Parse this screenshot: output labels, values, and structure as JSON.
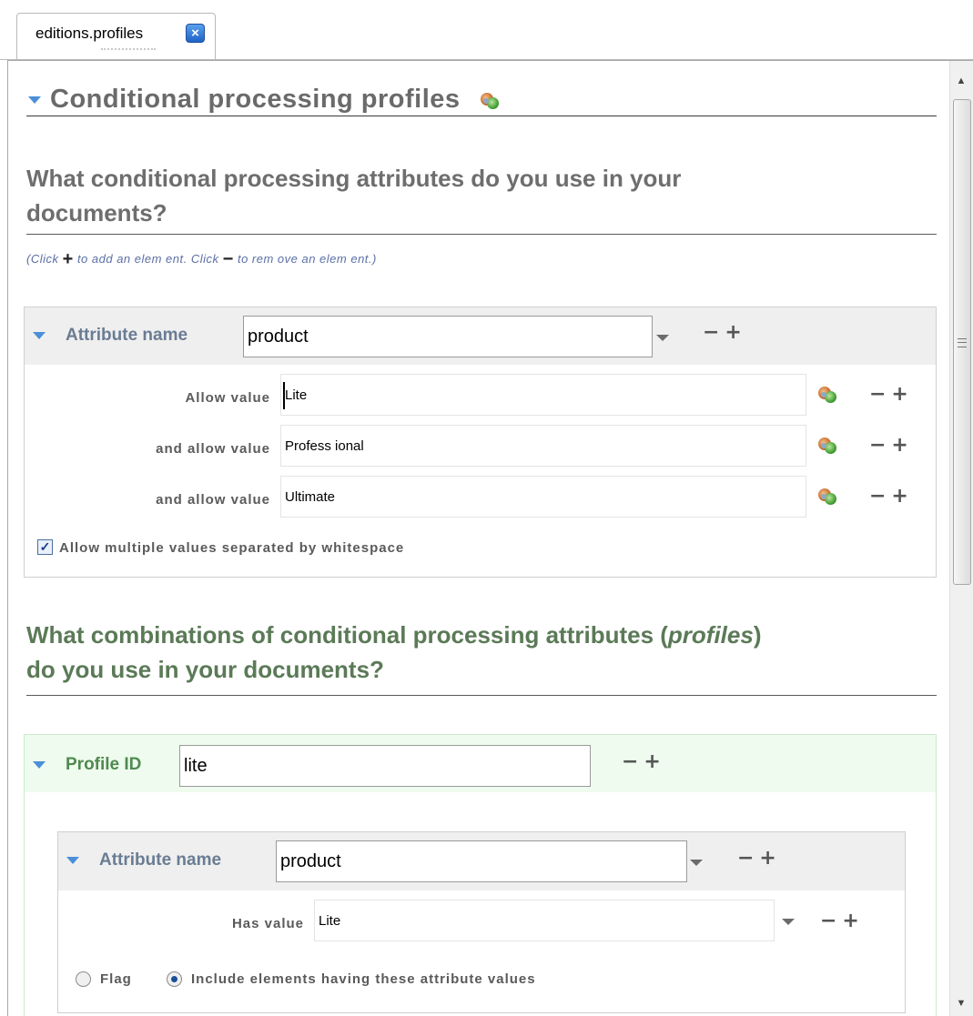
{
  "tab": {
    "title": "editions.profiles",
    "close_icon": "close-icon"
  },
  "section": {
    "title": "Conditional processing profiles"
  },
  "attributes": {
    "question_line1": "What conditional processing attributes do you use in your",
    "question_line2": "documents?",
    "hint_click": "(Click",
    "hint_add": "to add an elem ent. Click",
    "hint_remove": "to rem ove an elem ent.)",
    "plus_symbol": "+",
    "minus_symbol": "−",
    "block": {
      "name_label": "Attribute name",
      "name_value": "product",
      "values": [
        {
          "label": "Allow value",
          "value": "Lite"
        },
        {
          "label": "and allow value",
          "value": "Profess ional"
        },
        {
          "label": "and allow value",
          "value": "Ultimate"
        }
      ],
      "multi_values_label": "Allow multiple values separated by whitespace",
      "multi_values_checked": true
    }
  },
  "profiles": {
    "question_line1_a": "What combinations of conditional processing attributes (",
    "question_line1_em": "profiles",
    "question_line1_b": ")",
    "question_line2": "do you use in your documents?",
    "profile": {
      "id_label": "Profile ID",
      "id_value": "lite",
      "attribute": {
        "name_label": "Attribute name",
        "name_value": "product",
        "has_value_label": "Has value",
        "has_value": "Lite",
        "radio_flag": "Flag",
        "radio_include": "Include elements having these attribute values",
        "selected": "include"
      }
    }
  },
  "controls": {
    "minus_plus": "−+"
  },
  "colors": {
    "accent": "#4a8fd8",
    "profile_bg": "#eefbee",
    "header_bg": "#efefef"
  }
}
